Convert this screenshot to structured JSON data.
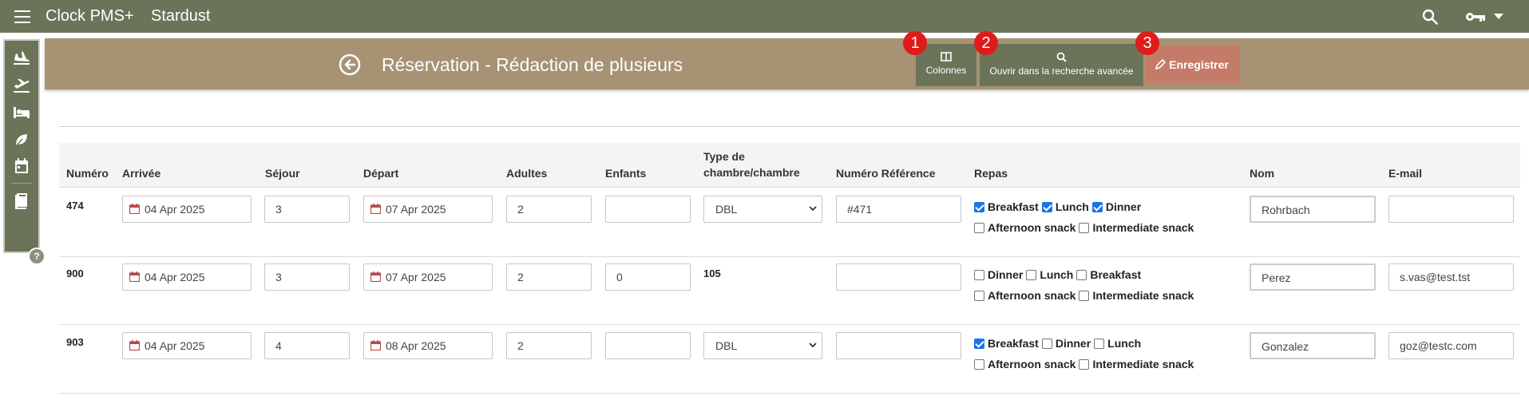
{
  "app": {
    "name": "Clock PMS+",
    "hotel": "Stardust"
  },
  "colors": {
    "topbar": "#6b7459",
    "title_band": "#a79274",
    "save": "#c47b68",
    "badge": "#e01b1b",
    "checkbox": "#1a73e8"
  },
  "icons": {
    "menu": "hamburger-icon",
    "search": "search-icon",
    "key": "key-icon",
    "back": "arrow-left-circle-icon",
    "calendar": "calendar-icon"
  },
  "sidebar": {
    "items": [
      "airplane-arrival-icon",
      "airplane-departure-icon",
      "bed-icon",
      "leaf-icon",
      "calendar-icon",
      "book-icon"
    ],
    "help": "?"
  },
  "page": {
    "title": "Réservation - Rédaction de plusieurs"
  },
  "toolbar": {
    "columns": "Colonnes",
    "advanced": "Ouvrir dans la recherche avancée",
    "save": "Enregistrer",
    "badges": [
      "1",
      "2",
      "3"
    ]
  },
  "table": {
    "headers": {
      "numero": "Numéro",
      "arrivee": "Arrivée",
      "sejour": "Séjour",
      "depart": "Départ",
      "adultes": "Adultes",
      "enfants": "Enfants",
      "type_line1": "Type de",
      "type_line2": "chambre/chambre",
      "reference": "Numéro Référence",
      "repas": "Repas",
      "nom": "Nom",
      "email": "E-mail"
    },
    "rows": [
      {
        "num": "474",
        "arrival": "04 Apr 2025",
        "stay": "3",
        "departure": "07 Apr 2025",
        "adults": "2",
        "children": "",
        "room_select": "DBL",
        "room_text": "",
        "reference": "#471",
        "meals": [
          [
            "Breakfast",
            true
          ],
          [
            "Lunch",
            true
          ],
          [
            "Dinner",
            true
          ],
          [
            "Afternoon snack",
            false
          ],
          [
            "Intermediate snack",
            false
          ]
        ],
        "name": "Rohrbach",
        "email": ""
      },
      {
        "num": "900",
        "arrival": "04 Apr 2025",
        "stay": "3",
        "departure": "07 Apr 2025",
        "adults": "2",
        "children": "0",
        "room_select": "",
        "room_text": "105",
        "reference": "",
        "meals": [
          [
            "Dinner",
            false
          ],
          [
            "Lunch",
            false
          ],
          [
            "Breakfast",
            false
          ],
          [
            "Afternoon snack",
            false
          ],
          [
            "Intermediate snack",
            false
          ]
        ],
        "name": "Perez",
        "email": "s.vas@test.tst"
      },
      {
        "num": "903",
        "arrival": "04 Apr 2025",
        "stay": "4",
        "departure": "08 Apr 2025",
        "adults": "2",
        "children": "",
        "room_select": "DBL",
        "room_text": "",
        "reference": "",
        "meals": [
          [
            "Breakfast",
            true
          ],
          [
            "Dinner",
            false
          ],
          [
            "Lunch",
            false
          ],
          [
            "Afternoon snack",
            false
          ],
          [
            "Intermediate snack",
            false
          ]
        ],
        "name": "Gonzalez",
        "email": "goz@testc.com"
      }
    ]
  }
}
